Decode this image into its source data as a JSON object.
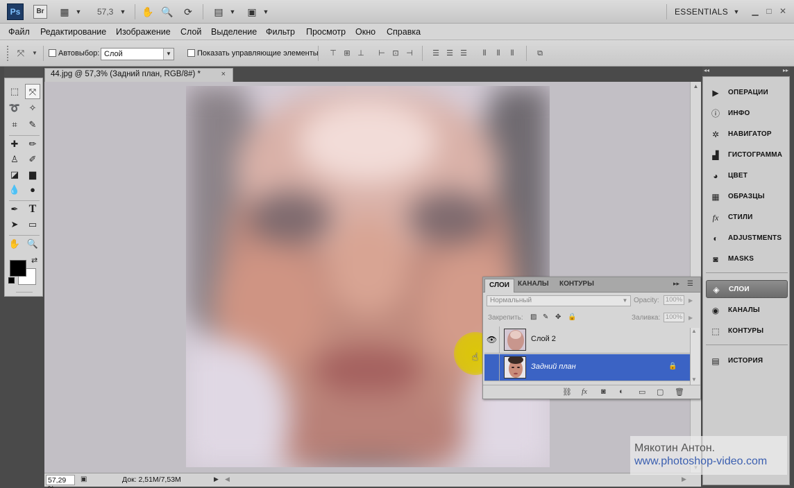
{
  "appbar": {
    "ps_logo": "Ps",
    "br_logo": "Br",
    "zoom": "57,3",
    "workspace": "ESSENTIALS"
  },
  "menu": [
    "Файл",
    "Редактирование",
    "Изображение",
    "Слой",
    "Выделение",
    "Фильтр",
    "Просмотр",
    "Окно",
    "Справка"
  ],
  "options": {
    "autoselect_label": "Автовыбор:",
    "autoselect_value": "Слой",
    "show_controls_label": "Показать управляющие элементы"
  },
  "document": {
    "tab_title": "44.jpg @ 57,3% (Задний план, RGB/8#) *",
    "close_glyph": "×"
  },
  "status": {
    "zoom": "57,29 %",
    "doc_info": "Док: 2,51M/7,53M"
  },
  "layers_panel": {
    "tabs": [
      "СЛОИ",
      "КАНАЛЫ",
      "КОНТУРЫ"
    ],
    "blend_mode": "Нормальный",
    "opacity_label": "Opacity:",
    "opacity_value": "100%",
    "lock_label": "Закрепить:",
    "fill_label": "Заливка:",
    "fill_value": "100%",
    "layers": [
      {
        "name": "Слой 2",
        "visible": true,
        "selected": false
      },
      {
        "name": "Задний план",
        "visible": false,
        "selected": true
      }
    ]
  },
  "dock": {
    "items": [
      {
        "label": "ОПЕРАЦИИ",
        "icon": "play-icon"
      },
      {
        "label": "ИНФО",
        "icon": "info-icon"
      },
      {
        "label": "НАВИГАТОР",
        "icon": "navigator-icon"
      },
      {
        "label": "ГИСТОГРАММА",
        "icon": "histogram-icon"
      },
      {
        "label": "ЦВЕТ",
        "icon": "color-icon"
      },
      {
        "label": "ОБРАЗЦЫ",
        "icon": "swatches-icon"
      },
      {
        "label": "СТИЛИ",
        "icon": "styles-icon"
      },
      {
        "label": "ADJUSTMENTS",
        "icon": "adjustments-icon"
      },
      {
        "label": "MASKS",
        "icon": "masks-icon"
      },
      {
        "label": "СЛОИ",
        "icon": "layers-icon"
      },
      {
        "label": "КАНАЛЫ",
        "icon": "channels-icon"
      },
      {
        "label": "КОНТУРЫ",
        "icon": "paths-icon"
      },
      {
        "label": "ИСТОРИЯ",
        "icon": "history-icon"
      }
    ]
  },
  "watermark": {
    "line1": "Мякотин Антон.",
    "line2": "www.photoshop-video.com"
  },
  "colors": {
    "selection_blue": "#3b63c4",
    "cursor_highlight": "#dcc800"
  }
}
